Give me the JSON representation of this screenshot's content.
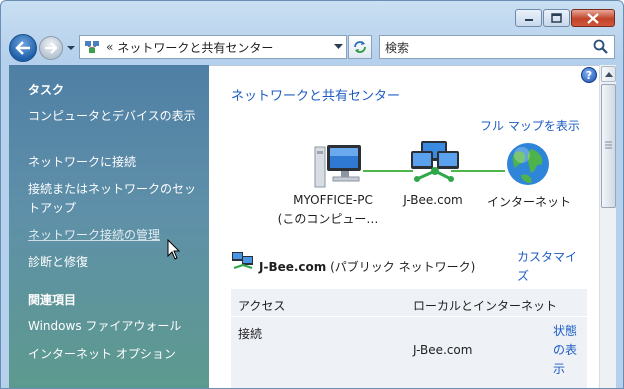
{
  "search": {
    "placeholder": "検索"
  },
  "address": {
    "separator": "«",
    "path": "ネットワークと共有センター"
  },
  "sidebar": {
    "tasks_heading": "タスク",
    "tasks": [
      {
        "label": "コンピュータとデバイスの表示"
      },
      {
        "label": "ネットワークに接続"
      },
      {
        "label": "接続またはネットワークのセットアップ"
      },
      {
        "label": "ネットワーク接続の管理"
      },
      {
        "label": "診断と修復"
      }
    ],
    "related_heading": "関連項目",
    "related": [
      {
        "label": "Windows ファイアウォール"
      },
      {
        "label": "インターネット オプション"
      }
    ]
  },
  "main": {
    "title": "ネットワークと共有センター",
    "full_map_link": "フル マップを表示",
    "map": {
      "computer_label_1": "MYOFFICE-PC",
      "computer_label_2": "(このコンピュー…",
      "network_label": "J-Bee.com",
      "internet_label": "インターネット"
    },
    "network": {
      "name": "J-Bee.com",
      "type": "(パブリック ネットワーク)",
      "customize_link": "カスタマイズ"
    },
    "details": {
      "access_label": "アクセス",
      "access_value": "ローカルとインターネット",
      "connection_label": "接続",
      "connection_value": "J-Bee.com",
      "status_link": "状態の表示"
    }
  },
  "colors": {
    "link": "#1d5cc4",
    "sidebar_top": "#4f7fa4",
    "sidebar_bottom": "#5d9a8e",
    "close_button": "#c1432a"
  }
}
